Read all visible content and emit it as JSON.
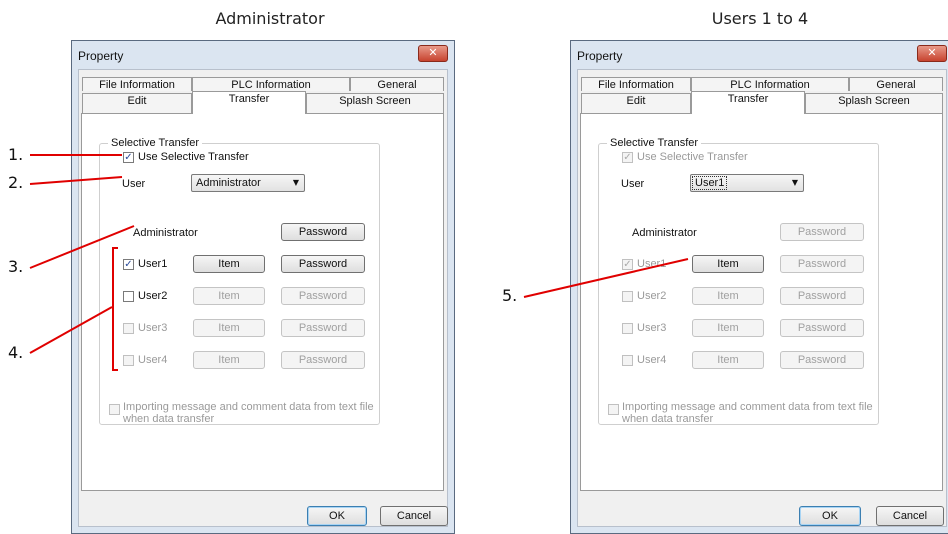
{
  "captions": {
    "left": "Administrator",
    "right": "Users 1 to 4"
  },
  "dialog": {
    "title": "Property",
    "close": "✕",
    "tabs_row1": [
      "File Information",
      "PLC Information",
      "General"
    ],
    "tabs_row2": [
      "Edit",
      "Transfer",
      "Splash Screen"
    ],
    "group_label": "Selective Transfer",
    "use_selective": "Use Selective Transfer",
    "user_label": "User",
    "administrator": "Administrator",
    "password": "Password",
    "item": "Item",
    "users": [
      "User1",
      "User2",
      "User3",
      "User4"
    ],
    "import_line1": "Importing message and comment data from text file",
    "import_line2": "when data transfer",
    "ok": "OK",
    "cancel": "Cancel"
  },
  "left_dialog": {
    "user_value": "Administrator"
  },
  "right_dialog": {
    "user_value": "User1"
  },
  "annotations": [
    "1.",
    "2.",
    "3.",
    "4.",
    "5."
  ],
  "colors": {
    "annotation": "#e00000",
    "title_bar": "#dbe5f1",
    "close_button": "#c7432f"
  }
}
